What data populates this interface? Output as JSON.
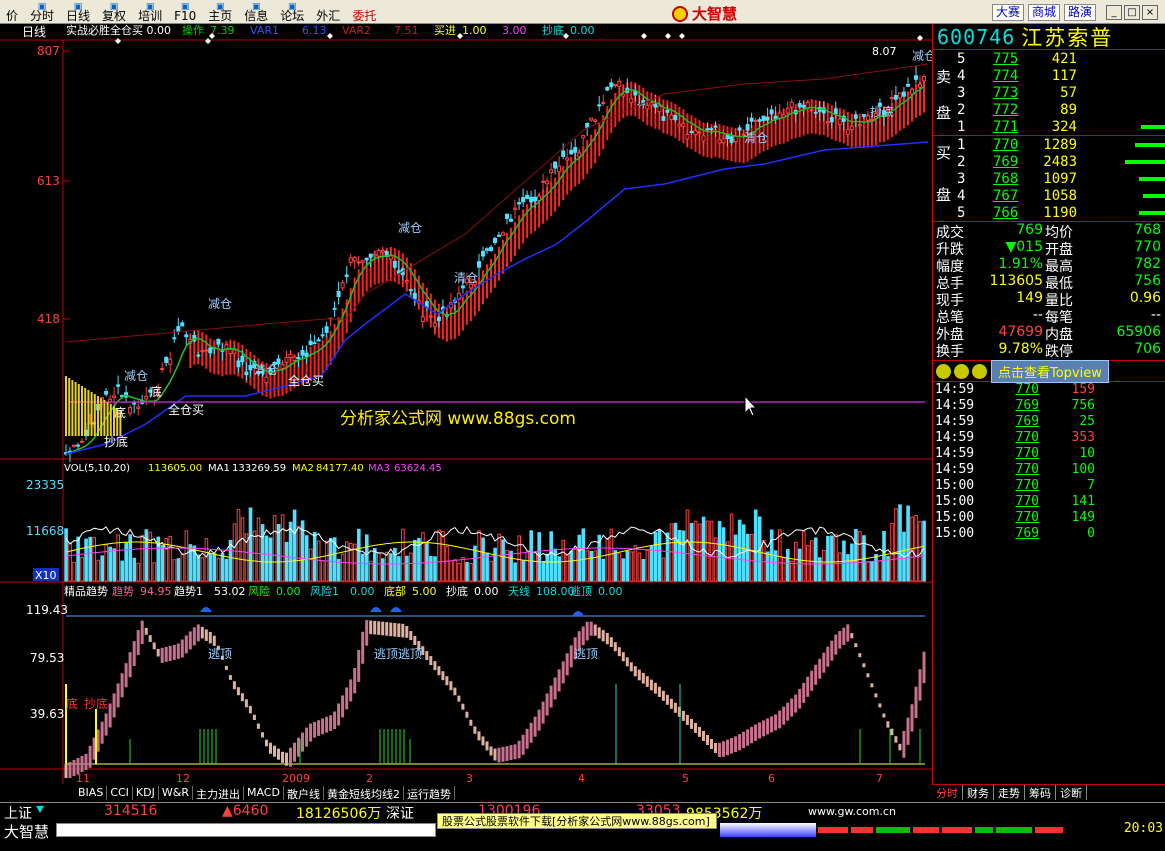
{
  "menu": [
    {
      "label": "价",
      "icon": ""
    },
    {
      "label": "分时",
      "icon": "intraday-icon"
    },
    {
      "label": "日线",
      "icon": "kline-icon"
    },
    {
      "label": "复权",
      "icon": "adjust-icon"
    },
    {
      "label": "培训",
      "icon": "training-icon"
    },
    {
      "label": "F10",
      "icon": "f10-icon"
    },
    {
      "label": "主页",
      "icon": "home-icon"
    },
    {
      "label": "信息",
      "icon": "info-icon"
    },
    {
      "label": "论坛",
      "icon": "forum-icon"
    },
    {
      "label": "外汇",
      "icon": ""
    },
    {
      "label": "委托",
      "icon": ""
    }
  ],
  "logo": "大智慧",
  "right_buttons": [
    "大赛",
    "商城",
    "路演"
  ],
  "window_buttons": [
    "_",
    "□",
    "×"
  ],
  "chart_header": {
    "period": "日线",
    "indicator": "实战必胜全仓买 0.00",
    "items": [
      {
        "label": "操作",
        "value": "7.39",
        "color": "#00cc00"
      },
      {
        "label": "VAR1",
        "value": "6.13",
        "color": "#3050ff"
      },
      {
        "label": "VAR2",
        "value": "7.51",
        "color": "#c02020"
      },
      {
        "label": "买进",
        "value": "1.00",
        "color": "#ffff00"
      },
      {
        "label": "",
        "value": "3.00",
        "color": "#ff40ff"
      },
      {
        "label": "抄底",
        "value": "0.00",
        "color": "#00e0e0"
      }
    ]
  },
  "y_labels_main": [
    "807",
    "613",
    "418"
  ],
  "y_labels_vol": [
    "23335",
    "11668"
  ],
  "vol_unit": "X10",
  "y_labels_ind": [
    "119.43",
    "79.53",
    "39.63"
  ],
  "x_labels": [
    "11",
    "12",
    "2009",
    "2",
    "3",
    "4",
    "5",
    "6",
    "7"
  ],
  "price_marker": "8.07",
  "annotations": [
    "减仓",
    "减仓",
    "减仓",
    "减仓",
    "清仓",
    "清仓",
    "清仓",
    "全仓买",
    "全仓买",
    "底",
    "抄底",
    "底",
    "抄底"
  ],
  "watermark": "分析家公式网 www.88gs.com",
  "vol_header": {
    "title": "VOL(5,10,20)",
    "vol": "113605.00",
    "ma1_label": "MA1",
    "ma1": "133269.59",
    "ma2_label": "MA2",
    "ma2": "84177.40",
    "ma3_label": "MA3",
    "ma3": "63624.45"
  },
  "ind_header": {
    "title": "精品趋势",
    "items": [
      {
        "label": "趋势",
        "value": "94.95",
        "color": "#ff60a0"
      },
      {
        "label": "趋势1",
        "value": "53.02",
        "color": "#ffffff"
      },
      {
        "label": "风险",
        "value": "0.00",
        "color": "#00ff00"
      },
      {
        "label": "风险1",
        "value": "0.00",
        "color": "#00e0e0"
      },
      {
        "label": "底部",
        "value": "5.00",
        "color": "#ffff00"
      },
      {
        "label": "抄底",
        "value": "0.00",
        "color": "#ffffff"
      },
      {
        "label": "天线",
        "value": "108.00",
        "color": "#00e0e0"
      },
      {
        "label": "逃顶",
        "value": "0.00",
        "color": "#00e0e0"
      }
    ]
  },
  "escape_labels": [
    "逃顶",
    "逃顶逃顶",
    "逃顶"
  ],
  "ind_bottom_labels": [
    "底",
    "抄底"
  ],
  "bottom_tabs": [
    "BIAS",
    "CCI",
    "KDJ",
    "W&R",
    "主力进出",
    "MACD",
    "散户线",
    "黄金短线均线2",
    "运行趋势"
  ],
  "stock": {
    "code": "600746",
    "name": "江苏索普"
  },
  "sell": {
    "label_top": "卖",
    "label_bot": "盘",
    "rows": [
      {
        "lv": "5",
        "px": "775",
        "vol": "421",
        "bar": 0
      },
      {
        "lv": "4",
        "px": "774",
        "vol": "117",
        "bar": 0
      },
      {
        "lv": "3",
        "px": "773",
        "vol": "57",
        "bar": 0
      },
      {
        "lv": "2",
        "px": "772",
        "vol": "89",
        "bar": 0
      },
      {
        "lv": "1",
        "px": "771",
        "vol": "324",
        "bar": 24
      }
    ]
  },
  "buy": {
    "label_top": "买",
    "label_bot": "盘",
    "rows": [
      {
        "lv": "1",
        "px": "770",
        "vol": "1289",
        "bar": 30
      },
      {
        "lv": "2",
        "px": "769",
        "vol": "2483",
        "bar": 40
      },
      {
        "lv": "3",
        "px": "768",
        "vol": "1097",
        "bar": 26
      },
      {
        "lv": "4",
        "px": "767",
        "vol": "1058",
        "bar": 22
      },
      {
        "lv": "5",
        "px": "766",
        "vol": "1190",
        "bar": 26
      }
    ]
  },
  "stats": [
    {
      "k1": "成交",
      "v1": "769",
      "c1": "g",
      "k2": "均价",
      "v2": "768",
      "c2": "g"
    },
    {
      "k1": "升跌",
      "v1": "▼015",
      "c1": "g",
      "k2": "开盘",
      "v2": "770",
      "c2": "g"
    },
    {
      "k1": "幅度",
      "v1": "1.91%",
      "c1": "g",
      "k2": "最高",
      "v2": "782",
      "c2": "g"
    },
    {
      "k1": "总手",
      "v1": "113605",
      "c1": "y",
      "k2": "最低",
      "v2": "756",
      "c2": "g"
    },
    {
      "k1": "现手",
      "v1": "149",
      "c1": "y",
      "k2": "量比",
      "v2": "0.96",
      "c2": "y"
    },
    {
      "k1": "总笔",
      "v1": "--",
      "c1": "w",
      "k2": "每笔",
      "v2": "--",
      "c2": "w"
    },
    {
      "k1": "外盘",
      "v1": "47699",
      "c1": "r",
      "k2": "内盘",
      "v2": "65906",
      "c2": "g"
    },
    {
      "k1": "换手",
      "v1": "9.78%",
      "c1": "y",
      "k2": "跌停",
      "v2": "706",
      "c2": "g"
    }
  ],
  "topview_label": "点击查看Topview",
  "ticks": [
    {
      "t": "14:59",
      "p": "770",
      "v": "159",
      "c": "#ff4040"
    },
    {
      "t": "14:59",
      "p": "769",
      "v": "756",
      "c": "#00ff00"
    },
    {
      "t": "14:59",
      "p": "769",
      "v": "25",
      "c": "#00ff00"
    },
    {
      "t": "14:59",
      "p": "770",
      "v": "353",
      "c": "#ff4040"
    },
    {
      "t": "14:59",
      "p": "770",
      "v": "10",
      "c": "#00ff00"
    },
    {
      "t": "14:59",
      "p": "770",
      "v": "100",
      "c": "#00ff00"
    },
    {
      "t": "15:00",
      "p": "770",
      "v": "7",
      "c": "#00ff00"
    },
    {
      "t": "15:00",
      "p": "770",
      "v": "141",
      "c": "#00ff00"
    },
    {
      "t": "15:00",
      "p": "770",
      "v": "149",
      "c": "#00ff00"
    },
    {
      "t": "15:00",
      "p": "769",
      "v": "0",
      "c": "#00ff00"
    }
  ],
  "right_tabs": [
    "分时",
    "财务",
    "走势",
    "筹码",
    "诊断"
  ],
  "status": {
    "sh_label": "上证",
    "sh_value": "314516",
    "sh_change": "▲6460",
    "sh_amount": "18126506万",
    "sz_label": "深证",
    "sz_value": "1300196",
    "sz_change": "33053",
    "sz_amount": "9853562万",
    "site": "www.gw.com.cn",
    "brand": "大智慧",
    "promo": "股票公式股票软件下载[分析家公式网www.88gs.com]",
    "clock": "20:03"
  },
  "colors": {
    "up": "#ff3030",
    "down": "#50e0ff",
    "ma_green": "#20c020",
    "support": "#2030ff",
    "bg": "#000000"
  }
}
